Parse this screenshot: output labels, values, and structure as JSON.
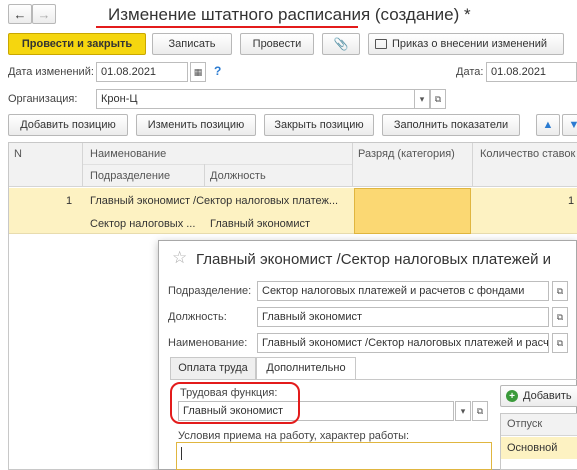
{
  "window": {
    "title": "Изменение штатного расписания (создание) *"
  },
  "toolbar": {
    "post_close": "Провести и закрыть",
    "save": "Записать",
    "post": "Провести",
    "order": "Приказ о внесении изменений"
  },
  "fields": {
    "change_date_label": "Дата изменений:",
    "change_date_value": "01.08.2021",
    "date_label": "Дата:",
    "date_value": "01.08.2021",
    "org_label": "Организация:",
    "org_value": "Крон-Ц"
  },
  "actions": {
    "add": "Добавить позицию",
    "edit": "Изменить позицию",
    "close": "Закрыть позицию",
    "fill": "Заполнить показатели"
  },
  "table": {
    "col_n": "N",
    "col_name": "Наименование",
    "col_dept": "Подразделение",
    "col_pos": "Должность",
    "col_rank": "Разряд (категория)",
    "col_qty": "Количество ставок",
    "row": {
      "n": "1",
      "name": "Главный экономист /Сектор налоговых платеж...",
      "dept": "Сектор налоговых ...",
      "pos": "Главный экономист",
      "qty": "1"
    }
  },
  "dialog": {
    "title": "Главный экономист /Сектор налоговых платежей и",
    "dept_label": "Подразделение:",
    "dept_value": "Сектор налоговых платежей и расчетов с фондами",
    "pos_label": "Должность:",
    "pos_value": "Главный экономист",
    "name_label": "Наименование:",
    "name_value": "Главный экономист /Сектор налоговых платежей и расчетов с",
    "tab_pay": "Оплата труда",
    "tab_extra": "Дополнительно",
    "func_label": "Трудовая функция:",
    "func_value": "Главный экономист",
    "conditions_label": "Условия приема на работу, характер работы:",
    "add_button": "Добавить",
    "leave_header": "Отпуск",
    "leave_row": "Основной"
  },
  "colors": {
    "accent": "#f5d60f",
    "annotation": "#e31b1b",
    "selection": "#fdf2c2"
  }
}
